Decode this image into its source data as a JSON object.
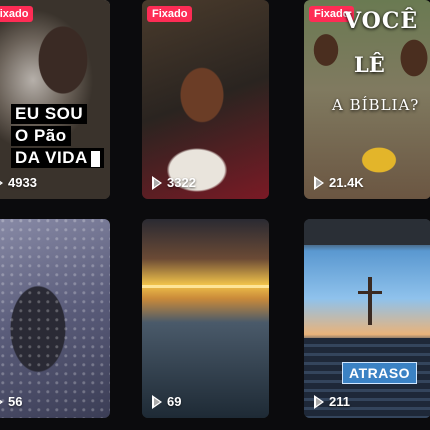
{
  "tiles": [
    {
      "pinned_label": "Fixado",
      "overlay_lines": [
        "EU SOU",
        "O Pão",
        "DA VIDA"
      ],
      "views": "4933"
    },
    {
      "pinned_label": "Fixado",
      "views": "3322"
    },
    {
      "pinned_label": "Fixado",
      "overlay_lines": [
        "VOCÊ",
        "LÊ",
        "A BÍBLIA?"
      ],
      "views": "21.4K"
    },
    {
      "views": "56"
    },
    {
      "views": "69"
    },
    {
      "overlay_label": "ATRASO",
      "views": "211"
    }
  ],
  "colors": {
    "pinned_badge": "#fe2c55",
    "atraso_badge": "#3b82c4"
  },
  "icons": {
    "views": "play-outline-icon"
  }
}
